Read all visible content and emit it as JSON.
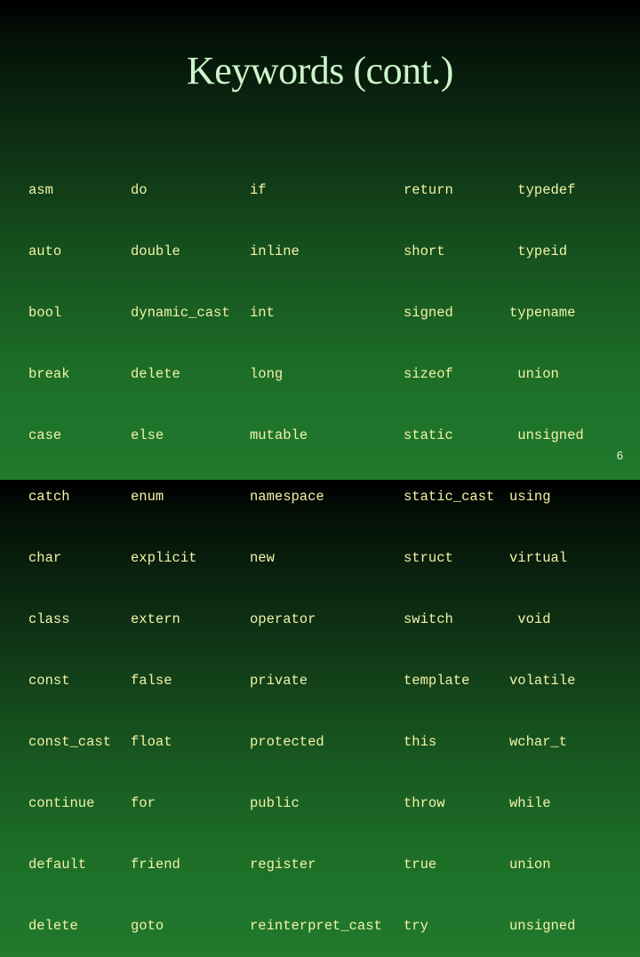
{
  "slide": {
    "title": "Keywords (cont.)",
    "page_number": "6"
  },
  "columns": [
    {
      "items": [
        "asm",
        "auto",
        "bool",
        "break",
        "case",
        "catch",
        "char",
        "class",
        "const",
        "const_cast",
        "continue",
        "default",
        "delete"
      ]
    },
    {
      "items": [
        "do",
        "double",
        "dynamic_cast",
        "delete",
        "else",
        "enum",
        "explicit",
        "extern",
        "false",
        "float",
        "for",
        "friend",
        "goto"
      ]
    },
    {
      "items": [
        "if",
        "inline",
        "int",
        "long",
        "mutable",
        "namespace",
        "new",
        "operator",
        "private",
        "protected",
        "public",
        "register",
        "reinterpret_cast"
      ]
    },
    {
      "items": [
        "return",
        "short",
        "signed",
        "sizeof",
        "static",
        "static_cast",
        "struct",
        "switch",
        "template",
        "this",
        "throw",
        "true",
        "try"
      ]
    },
    {
      "items": [
        " typedef",
        " typeid",
        "typename",
        " union",
        " unsigned",
        "using",
        "virtual",
        " void",
        "volatile",
        "wchar_t",
        "while",
        "union",
        "unsigned"
      ]
    }
  ],
  "colors": {
    "title": "#ccf5cc",
    "keyword_text": "#f3f3a6",
    "background_top": "#000000",
    "background_bottom": "#217a2e"
  }
}
